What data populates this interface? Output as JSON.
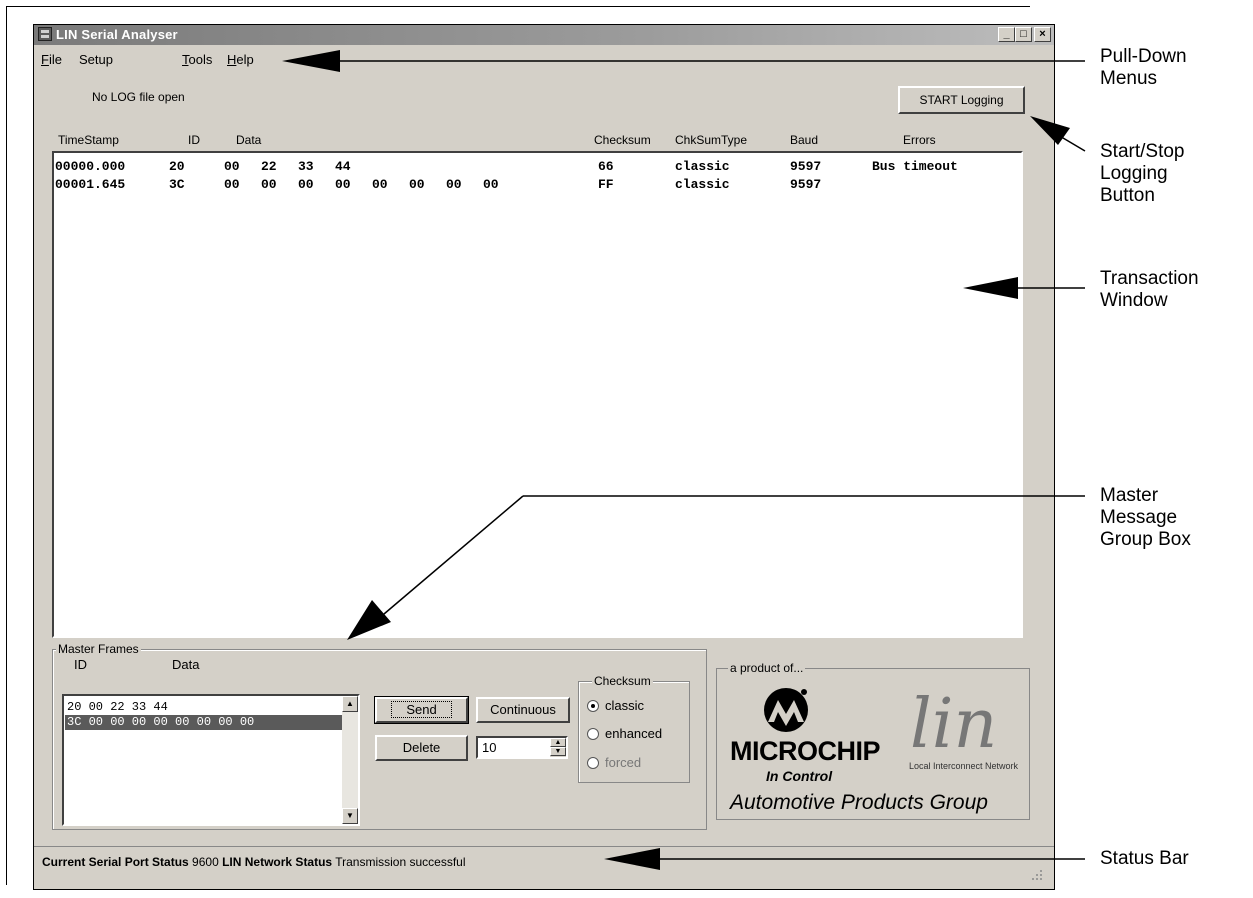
{
  "window": {
    "title": "LIN Serial Analyser",
    "controls": [
      "_",
      "□",
      "×"
    ]
  },
  "menu": {
    "items": [
      {
        "label": "File",
        "underline": "F"
      },
      {
        "label": "Setup",
        "underline": ""
      },
      {
        "label": "Tools",
        "underline": "T"
      },
      {
        "label": "Help",
        "underline": "H"
      }
    ]
  },
  "log": {
    "status": "No LOG file open",
    "start_button": "START Logging"
  },
  "transactions": {
    "columns": [
      "TimeStamp",
      "ID",
      "Data",
      "Checksum",
      "ChkSumType",
      "Baud",
      "Errors"
    ],
    "rows": [
      {
        "timestamp": "00000.000",
        "id": "20",
        "data": [
          "00",
          "22",
          "33",
          "44"
        ],
        "checksum": "66",
        "type": "classic",
        "baud": "9597",
        "errors": "Bus timeout"
      },
      {
        "timestamp": "00001.645",
        "id": "3C",
        "data": [
          "00",
          "00",
          "00",
          "00",
          "00",
          "00",
          "00",
          "00"
        ],
        "checksum": "FF",
        "type": "classic",
        "baud": "9597",
        "errors": ""
      }
    ]
  },
  "master_frames": {
    "group_label": "Master Frames",
    "id_header": "ID",
    "data_header": "Data",
    "frames": [
      "20 00 22 33 44",
      "3C 00 00 00 00 00 00 00 00"
    ],
    "selected_index": 1,
    "send_label": "Send",
    "continuous_label": "Continuous",
    "delete_label": "Delete",
    "interval_value": "10"
  },
  "checksum_options": {
    "group_label": "Checksum",
    "options": [
      "classic",
      "enhanced",
      "forced"
    ],
    "selected": "classic"
  },
  "logo": {
    "group_label": "a product of...",
    "microchip": "MICROCHIP",
    "microchip_tagline": "In Control",
    "lin": "lin",
    "lin_tagline": "Local Interconnect Network",
    "group_text": "Automotive Products Group"
  },
  "status_bar": {
    "serial_label": "Current Serial Port Status",
    "serial_value": "9600",
    "network_label": "LIN Network Status",
    "network_value": "Transmission successful"
  },
  "callouts": {
    "pulldown": [
      "Pull-Down",
      "Menus"
    ],
    "startstop": [
      "Start/Stop",
      "Logging",
      "Button"
    ],
    "transaction": [
      "Transaction",
      "Window"
    ],
    "master": [
      "Master",
      "Message",
      "Group Box"
    ],
    "statusbar": [
      "Status Bar"
    ]
  }
}
